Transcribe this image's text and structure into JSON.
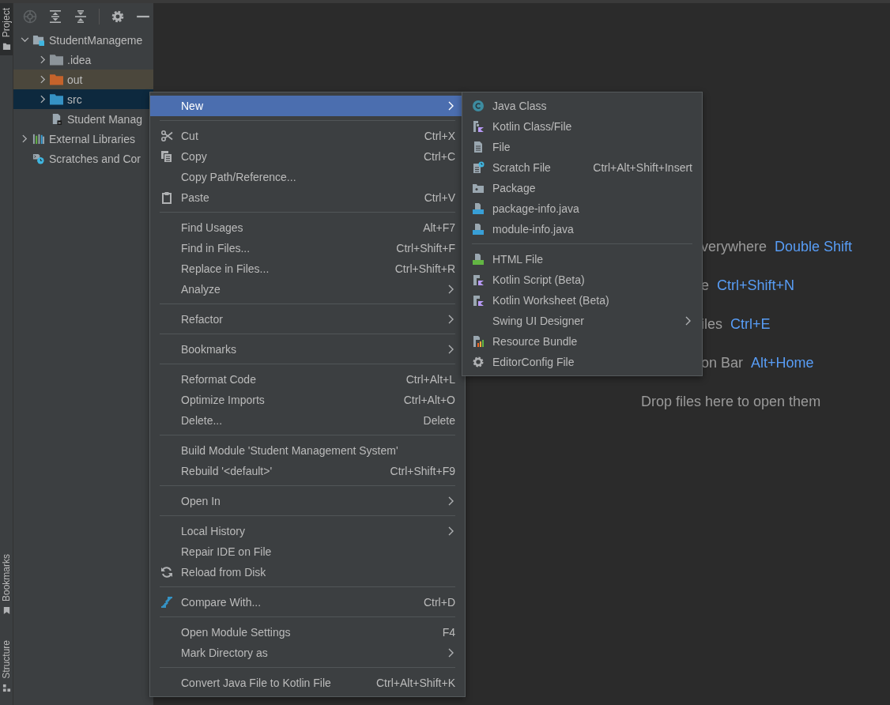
{
  "tool_window_stripe": {
    "top_tabs": [
      {
        "label": "Project",
        "selected": true
      }
    ],
    "bottom_tabs": [
      {
        "label": "Bookmarks",
        "selected": false
      },
      {
        "label": "Structure",
        "selected": false
      }
    ]
  },
  "project_tree": [
    {
      "label": "StudentManageme",
      "kind": "module",
      "expanded": true,
      "selected": false,
      "highlighted": false,
      "children": [
        {
          "label": ".idea",
          "kind": "folder",
          "color": "#8c949a",
          "expanded": false,
          "selected": false,
          "highlighted": false
        },
        {
          "label": "out",
          "kind": "folder",
          "color": "#c5632b",
          "expanded": false,
          "selected": false,
          "highlighted": true
        },
        {
          "label": "src",
          "kind": "folder",
          "color": "#3592c4",
          "expanded": false,
          "selected": true,
          "highlighted": false
        },
        {
          "label": "Student Manag",
          "kind": "file",
          "selected": false,
          "highlighted": false
        }
      ]
    },
    {
      "label": "External Libraries",
      "kind": "libraries",
      "expanded": false,
      "selected": false,
      "highlighted": false
    },
    {
      "label": "Scratches and Cor",
      "kind": "scratches",
      "selected": false,
      "highlighted": false
    }
  ],
  "context_menu": {
    "items": [
      {
        "kind": "plain",
        "label": "New",
        "submenu": true,
        "selected": true
      },
      {
        "kind": "separator"
      },
      {
        "kind": "scissors",
        "label": "Cut",
        "shortcut": "Ctrl+X",
        "selected": false
      },
      {
        "kind": "copy",
        "label": "Copy",
        "shortcut": "Ctrl+C",
        "selected": false
      },
      {
        "kind": "plain",
        "label": "Copy Path/Reference...",
        "selected": false
      },
      {
        "kind": "clipboard",
        "label": "Paste",
        "shortcut": "Ctrl+V",
        "selected": false
      },
      {
        "kind": "separator"
      },
      {
        "kind": "plain",
        "label": "Find Usages",
        "shortcut": "Alt+F7",
        "selected": false
      },
      {
        "kind": "plain",
        "label": "Find in Files...",
        "shortcut": "Ctrl+Shift+F",
        "selected": false
      },
      {
        "kind": "plain",
        "label": "Replace in Files...",
        "shortcut": "Ctrl+Shift+R",
        "selected": false
      },
      {
        "kind": "plain",
        "label": "Analyze",
        "submenu": true,
        "selected": false
      },
      {
        "kind": "separator"
      },
      {
        "kind": "plain",
        "label": "Refactor",
        "submenu": true,
        "selected": false
      },
      {
        "kind": "separator"
      },
      {
        "kind": "plain",
        "label": "Bookmarks",
        "submenu": true,
        "selected": false
      },
      {
        "kind": "separator"
      },
      {
        "kind": "plain",
        "label": "Reformat Code",
        "shortcut": "Ctrl+Alt+L",
        "selected": false
      },
      {
        "kind": "plain",
        "label": "Optimize Imports",
        "shortcut": "Ctrl+Alt+O",
        "selected": false
      },
      {
        "kind": "plain",
        "label": "Delete...",
        "shortcut": "Delete",
        "selected": false
      },
      {
        "kind": "separator"
      },
      {
        "kind": "plain",
        "label": "Build Module 'Student Management System'",
        "selected": false
      },
      {
        "kind": "plain",
        "label": "Rebuild '<default>'",
        "shortcut": "Ctrl+Shift+F9",
        "selected": false
      },
      {
        "kind": "separator"
      },
      {
        "kind": "plain",
        "label": "Open In",
        "submenu": true,
        "selected": false
      },
      {
        "kind": "separator"
      },
      {
        "kind": "plain",
        "label": "Local History",
        "submenu": true,
        "selected": false
      },
      {
        "kind": "plain",
        "label": "Repair IDE on File",
        "selected": false
      },
      {
        "kind": "reload",
        "label": "Reload from Disk",
        "selected": false
      },
      {
        "kind": "separator"
      },
      {
        "kind": "compare",
        "label": "Compare With...",
        "shortcut": "Ctrl+D",
        "selected": false
      },
      {
        "kind": "separator"
      },
      {
        "kind": "plain",
        "label": "Open Module Settings",
        "shortcut": "F4",
        "selected": false
      },
      {
        "kind": "plain",
        "label": "Mark Directory as",
        "submenu": true,
        "selected": false
      },
      {
        "kind": "separator"
      },
      {
        "kind": "plain",
        "label": "Convert Java File to Kotlin File",
        "shortcut": "Ctrl+Alt+Shift+K",
        "selected": false
      }
    ]
  },
  "new_submenu": {
    "items": [
      {
        "kind": "javaclass",
        "label": "Java Class",
        "selected": false
      },
      {
        "kind": "kotlin",
        "label": "Kotlin Class/File",
        "selected": false
      },
      {
        "kind": "file",
        "label": "File",
        "selected": false
      },
      {
        "kind": "scratch",
        "label": "Scratch File",
        "shortcut": "Ctrl+Alt+Shift+Insert",
        "selected": false
      },
      {
        "kind": "package",
        "label": "Package",
        "selected": false
      },
      {
        "kind": "javainfo",
        "label": "package-info.java",
        "selected": false
      },
      {
        "kind": "javainfo",
        "label": "module-info.java",
        "selected": false
      },
      {
        "kind": "separator"
      },
      {
        "kind": "html",
        "label": "HTML File",
        "selected": false
      },
      {
        "kind": "kscript",
        "label": "Kotlin Script (Beta)",
        "selected": false
      },
      {
        "kind": "kscript",
        "label": "Kotlin Worksheet (Beta)",
        "selected": false
      },
      {
        "kind": "plain",
        "label": "Swing UI Designer",
        "submenu": true,
        "selected": false
      },
      {
        "kind": "bundle",
        "label": "Resource Bundle",
        "selected": false
      },
      {
        "kind": "gear",
        "label": "EditorConfig File",
        "selected": false
      }
    ]
  },
  "editor_hints": [
    {
      "text": "verywhere",
      "shortcut": "Double Shift"
    },
    {
      "text": "e",
      "shortcut": "Ctrl+Shift+N"
    },
    {
      "text": "iles",
      "shortcut": "Ctrl+E"
    },
    {
      "text": "on Bar",
      "shortcut": "Alt+Home"
    }
  ],
  "editor_drop_text": "Drop files here to open them"
}
